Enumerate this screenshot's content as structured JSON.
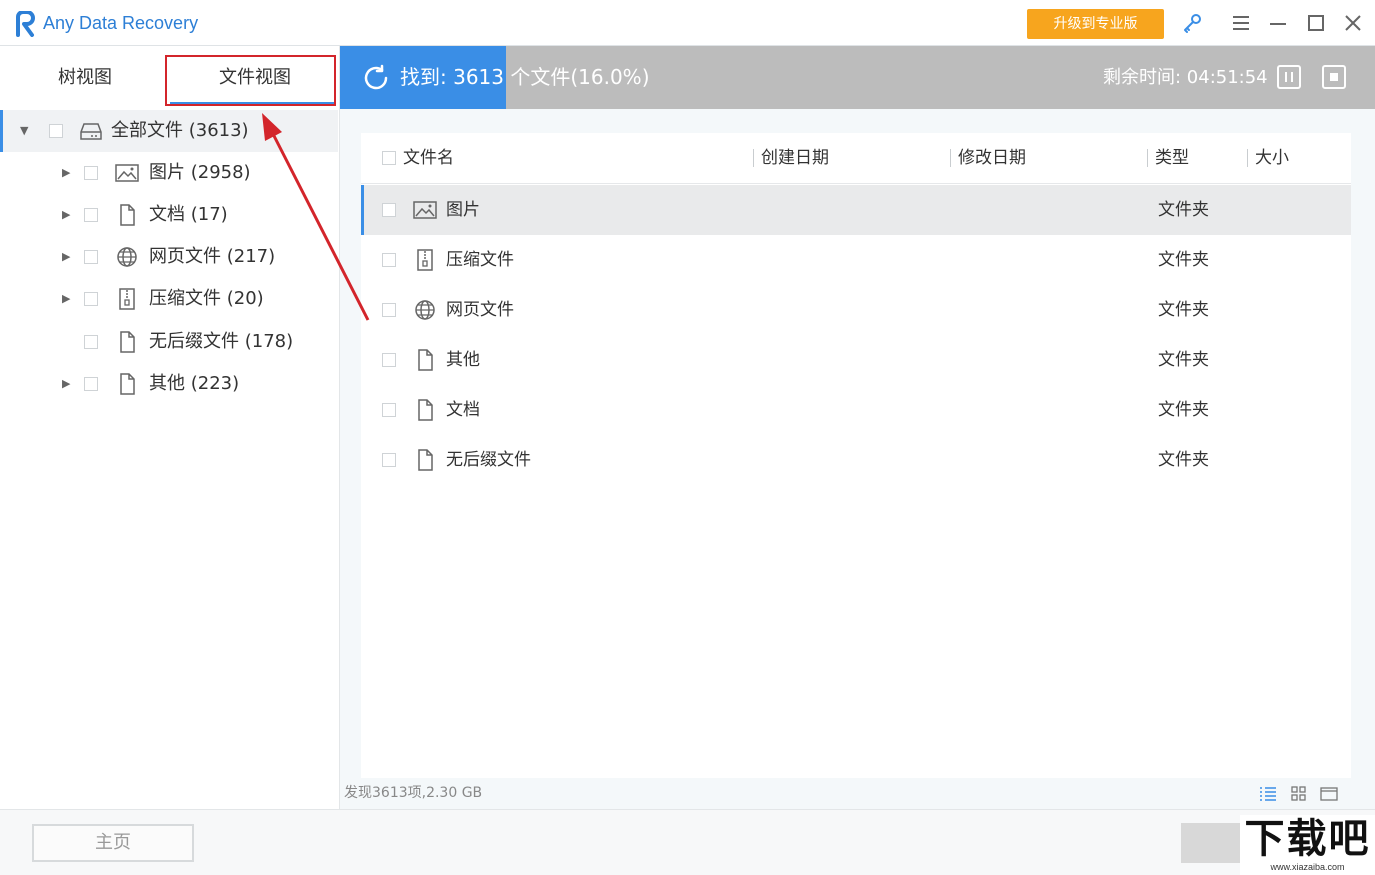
{
  "app": {
    "title": "Any Data Recovery",
    "upgrade_label": "升级到专业版"
  },
  "tabs": {
    "tree_view": "树视图",
    "file_view": "文件视图"
  },
  "tree": [
    {
      "label": "全部文件 (3613)",
      "icon": "drive-icon"
    },
    {
      "label": "图片 (2958)",
      "icon": "image-icon"
    },
    {
      "label": "文档 (17)",
      "icon": "document-icon"
    },
    {
      "label": "网页文件 (217)",
      "icon": "globe-icon"
    },
    {
      "label": "压缩文件 (20)",
      "icon": "archive-icon"
    },
    {
      "label": "无后缀文件 (178)",
      "icon": "document-icon"
    },
    {
      "label": "其他 (223)",
      "icon": "document-icon"
    }
  ],
  "scan": {
    "found_text": "找到: 3613 个文件(16.0%)",
    "progress_percent": 16.0,
    "remaining_text": "剩余时间: 04:51:54"
  },
  "table": {
    "headers": {
      "name": "文件名",
      "created": "创建日期",
      "modified": "修改日期",
      "type": "类型",
      "size": "大小"
    },
    "rows": [
      {
        "name": "图片",
        "type": "文件夹",
        "icon": "image-icon"
      },
      {
        "name": "压缩文件",
        "type": "文件夹",
        "icon": "archive-icon"
      },
      {
        "name": "网页文件",
        "type": "文件夹",
        "icon": "globe-icon"
      },
      {
        "name": "其他",
        "type": "文件夹",
        "icon": "document-icon"
      },
      {
        "name": "文档",
        "type": "文件夹",
        "icon": "document-icon"
      },
      {
        "name": "无后缀文件",
        "type": "文件夹",
        "icon": "document-icon"
      }
    ]
  },
  "status": {
    "summary": "发现3613项,2.30 GB"
  },
  "footer": {
    "home_label": "主页"
  },
  "watermark": {
    "text": "下载吧",
    "url": "www.xiazaiba.com"
  },
  "colors": {
    "accent": "#3a8ee6",
    "upgrade": "#f7a51e",
    "highlight": "#d3252b"
  }
}
